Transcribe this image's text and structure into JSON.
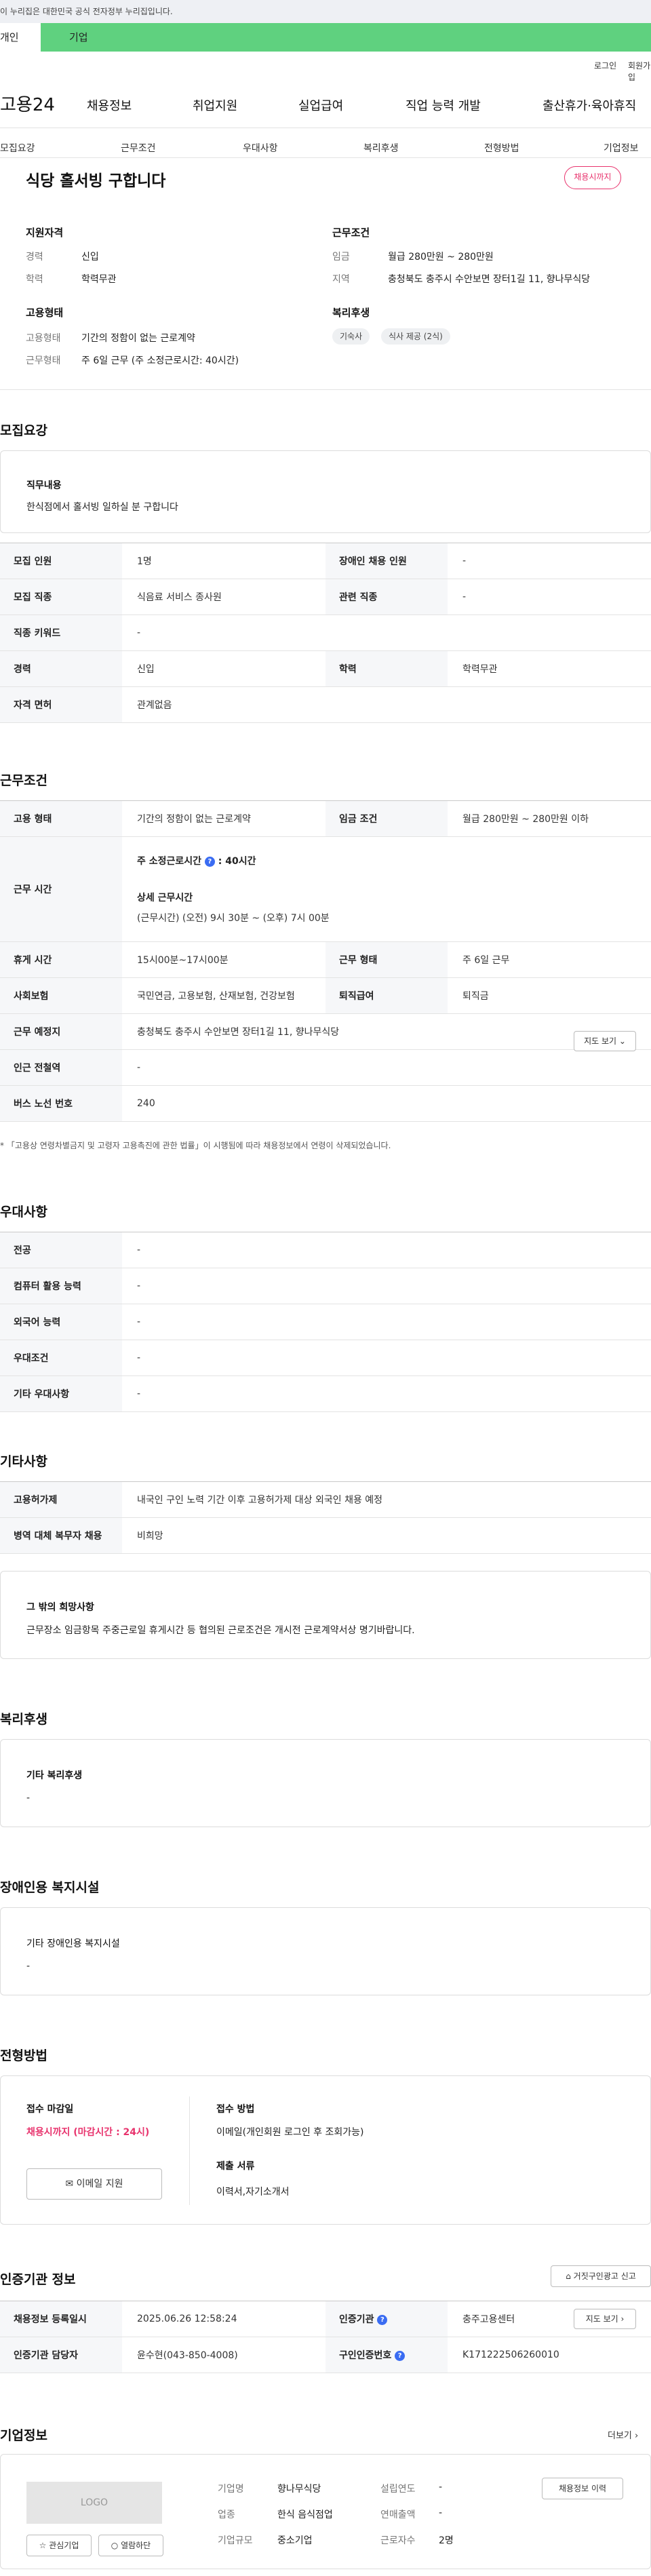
{
  "gov_banner": "이 누리집은 대한민국 공식 전자정부 누리집입니다.",
  "top_tabs": {
    "personal": "개인",
    "company": "기업"
  },
  "util": {
    "login": "로그인",
    "join": "회원가입"
  },
  "logo": "고용24",
  "gnb": [
    "채용정보",
    "취업지원",
    "실업급여",
    "직업 능력 개발",
    "출산휴가·육아휴직"
  ],
  "anchor_tabs": [
    "모집요강",
    "근무조건",
    "우대사항",
    "복리후생",
    "전형방법",
    "기업정보"
  ],
  "job_title": "식당 홀서빙 구합니다",
  "status_badge": "채용시까지",
  "summary": {
    "qual_title": "지원자격",
    "career_label": "경력",
    "career_value": "신입",
    "edu_label": "학력",
    "edu_value": "학력무관",
    "type_title": "고용형태",
    "emp_label": "고용형태",
    "emp_value": "기간의 정함이 없는 근로계약",
    "work_label": "근무형태",
    "work_value": "주 6일 근무 (주 소정근로시간: 40시간)",
    "cond_title": "근무조건",
    "wage_label": "임금",
    "wage_value": "월급 280만원 ~ 280만원",
    "area_label": "지역",
    "area_value": "충청북도 충주시 수안보면 장터1길 11, 향나무식당",
    "welfare_title": "복리후생",
    "chips": [
      "기숙사",
      "식사 제공 (2식)"
    ]
  },
  "recruit": {
    "section_title": "모집요강",
    "duty_title": "직무내용",
    "duty_text": "한식점에서 홀서빙 일하실 분 구합니다",
    "rows": [
      {
        "l1": "모집 인원",
        "v1": "1명",
        "l2": "장애인 채용 인원",
        "v2": "-"
      },
      {
        "l1": "모집 직종",
        "v1": "식음료 서비스 종사원",
        "l2": "관련 직종",
        "v2": "-"
      },
      {
        "l1": "직종 키워드",
        "v1": "-"
      },
      {
        "l1": "경력",
        "v1": "신입",
        "l2": "학력",
        "v2": "학력무관"
      },
      {
        "l1": "자격 면허",
        "v1": "관계없음"
      }
    ]
  },
  "work": {
    "section_title": "근무조건",
    "emp_type_l": "고용 형태",
    "emp_type_v": "기간의 정함이 없는 근로계약",
    "wage_l": "임금 조건",
    "wage_v": "월급 280만원 ~ 280만원 이하",
    "hours_l": "근무 시간",
    "hours_week": "주 소정근로시간",
    "hours_week_v": ": 40시간",
    "hours_detail_title": "상세 근무시간",
    "hours_detail": "(근무시간) (오전) 9시 30분 ~ (오후) 7시 00분",
    "rest_l": "휴게 시간",
    "rest_v": "15시00분~17시00분",
    "form_l": "근무 형태",
    "form_v": "주 6일 근무",
    "ins_l": "사회보험",
    "ins_v": "국민연금, 고용보험, 산재보험, 건강보험",
    "retire_l": "퇴직급여",
    "retire_v": "퇴직금",
    "place_l": "근무 예정지",
    "place_v": "충청북도 충주시 수안보면 장터1길 11, 향나무식당",
    "map_btn": "지도 보기",
    "subway_l": "인근 전철역",
    "subway_v": "-",
    "bus_l": "버스 노선 번호",
    "bus_v": "240",
    "note": "* 「고용상 연령차별금지 및 고령자 고용촉진에 관한 법률」이 시행됨에 따라 채용정보에서 연령이 삭제되었습니다."
  },
  "pref": {
    "section_title": "우대사항",
    "rows": [
      {
        "l": "전공",
        "v": "-"
      },
      {
        "l": "컴퓨터 활용 능력",
        "v": "-"
      },
      {
        "l": "외국어 능력",
        "v": "-"
      },
      {
        "l": "우대조건",
        "v": "-"
      },
      {
        "l": "기타 우대사항",
        "v": "-"
      }
    ]
  },
  "etc": {
    "section_title": "기타사항",
    "rows": [
      {
        "l": "고용허가제",
        "v": "내국인 구인 노력 기간 이후 고용허가제 대상 외국인 채용 예정"
      },
      {
        "l": "병역 대체 복무자 채용",
        "v": "비희망"
      }
    ],
    "wish_title": "그 밖의 희망사항",
    "wish_text": "근무장소 임금항목 주중근로일 휴게시간 등 협의된 근로조건은 개시전 근로계약서상 명기바랍니다."
  },
  "welfare": {
    "section_title": "복리후생",
    "box_title": "기타 복리후생",
    "box_value": "-"
  },
  "disabled": {
    "section_title": "장애인용 복지시설",
    "box_title": "기타 장애인용 복지시설",
    "box_value": "-"
  },
  "selection": {
    "section_title": "전형방법",
    "deadline_title": "접수 마감일",
    "deadline_value": "채용시까지 (마감시간 : 24시)",
    "email_btn": "이메일 지원",
    "method_title": "접수 방법",
    "method_value": "이메일(개인회원 로그인 후 조회가능)",
    "docs_title": "제출 서류",
    "docs_value": "이력서,자기소개서"
  },
  "cert": {
    "section_title": "인증기관 정보",
    "report_btn": "거짓구인광고 신고",
    "reg_l": "채용정보 등록일시",
    "reg_v": "2025.06.26 12:58:24",
    "org_l": "인증기관",
    "org_v": "충주고용센터",
    "map_btn": "지도 보기",
    "mgr_l": "인증기관 담당자",
    "mgr_v": "윤수현(043-850-4008)",
    "no_l": "구인인증번호",
    "no_v": "K171222506260010"
  },
  "company": {
    "section_title": "기업정보",
    "more": "더보기",
    "logo": "LOGO",
    "fav_btn": "관심기업",
    "view_btn": "열람하단",
    "name_l": "기업명",
    "name_v": "향나무식당",
    "ind_l": "업종",
    "ind_v": "한식 음식점업",
    "size_l": "기업규모",
    "size_v": "중소기업",
    "year_l": "설립연도",
    "year_v": "-",
    "sales_l": "연매출액",
    "sales_v": "-",
    "emp_l": "근로자수",
    "emp_v": "2명",
    "hire_btn": "채용정보 이력"
  },
  "colors": {
    "accent": "#e8336d",
    "tab_green": "#5fd17f",
    "info_blue": "#3a6cf2"
  }
}
